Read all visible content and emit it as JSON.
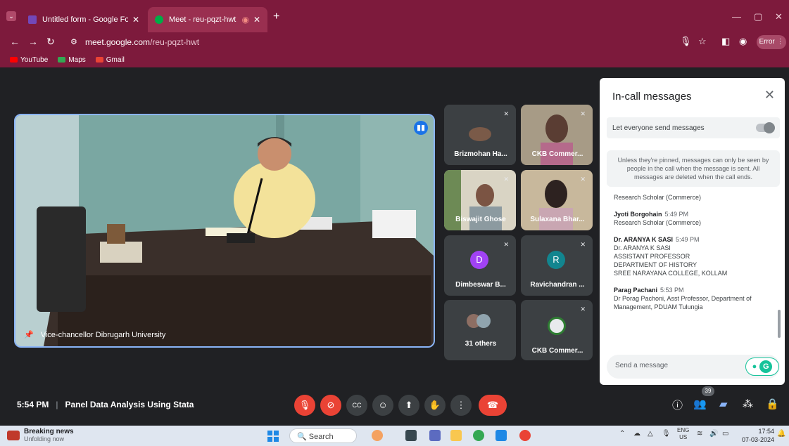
{
  "browser": {
    "tabs": [
      {
        "label": "Untitled form - Google Forms",
        "icon": "google-forms-icon",
        "color": "#7248b9"
      },
      {
        "label": "Meet - reu-pqzt-hwt",
        "icon": "google-meet-icon",
        "color": "#00ac47"
      }
    ],
    "url_host": "meet.google.com",
    "url_path": "/reu-pqzt-hwt",
    "error_label": "Error",
    "bookmarks": [
      {
        "label": "YouTube",
        "color": "#ff0000"
      },
      {
        "label": "Maps",
        "color": "#34a853"
      },
      {
        "label": "Gmail",
        "color": "#ea4335"
      }
    ],
    "theme_color": "#7d1a3c"
  },
  "meeting": {
    "time": "5:54 PM",
    "title": "Panel Data Analysis Using Stata",
    "main_speaker": "Vice-chancellor Dibrugarh University",
    "participants": [
      {
        "name": "Brizmohan Ha...",
        "type": "video"
      },
      {
        "name": "CKB Commer...",
        "type": "video"
      },
      {
        "name": "Biswajit Ghose",
        "type": "video"
      },
      {
        "name": "Sulaxana Bhar...",
        "type": "video"
      },
      {
        "name": "Dimbeswar B...",
        "type": "avatar",
        "initial": "D",
        "color": "#a142f4"
      },
      {
        "name": "Ravichandran ...",
        "type": "avatar",
        "initial": "R",
        "color": "#12858f"
      },
      {
        "name": "31 others",
        "type": "group"
      },
      {
        "name": "CKB Commer...",
        "type": "logo"
      }
    ],
    "people_count": "39"
  },
  "chat": {
    "title": "In-call messages",
    "toggle_label": "Let everyone send messages",
    "info": "Unless they're pinned, messages can only be seen by people in the call when the message is sent. All messages are deleted when the call ends.",
    "messages": [
      {
        "sender": "",
        "time": "",
        "lines": [
          "Research Scholar (Commerce)"
        ]
      },
      {
        "sender": "Jyoti Borgohain",
        "time": "5:49 PM",
        "lines": [
          "Research Scholar (Commerce)"
        ]
      },
      {
        "sender": "Dr. ARANYA K SASI",
        "time": "5:49 PM",
        "lines": [
          "Dr. ARANYA K SASI",
          "ASSISTANT PROFESSOR",
          "DEPARTMENT OF HISTORY",
          "SREE NARAYANA COLLEGE, KOLLAM"
        ]
      },
      {
        "sender": "Parag Pachani",
        "time": "5:53 PM",
        "lines": [
          "Dr Porag Pachoni, Asst Professor, Department of Management, PDUAM Tulungia"
        ]
      }
    ],
    "send_placeholder": "Send a message"
  },
  "taskbar": {
    "news_title": "Breaking news",
    "news_sub": "Unfolding now",
    "search": "Search",
    "lang": "ENG",
    "region": "US",
    "time": "17:54",
    "date": "07-03-2024"
  }
}
